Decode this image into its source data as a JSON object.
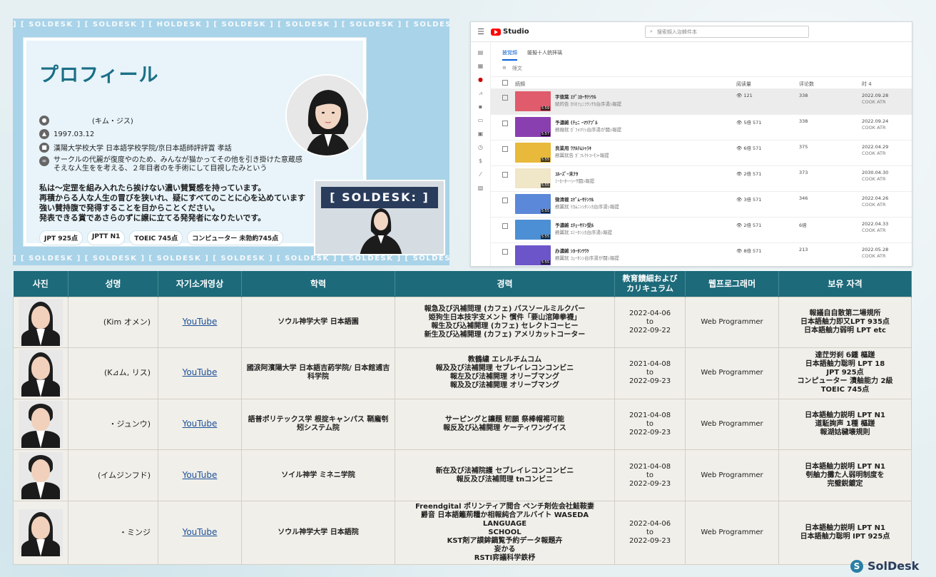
{
  "profile": {
    "marquee": "] [ SOLDESK ] [ SOLDESK ] [ HOLDESK ] [ SOLDESK ] [ SOLDESK ] [ SOLDESK ] [ SOLDESK ] [ SOLDESK ]",
    "marquee_bottom": "] [ SOLDESK ] [ SOLDESK ] [ SOLDESK ] [ SOLDESK ] [ SOLDESK ] [ SOLDESK ] [ SOLDESK ]",
    "title": "プロフィール",
    "name": "(キム・ジス)",
    "birth": "1997.03.12",
    "school": "漢陽大学校大学 日本語学校学院/京日本語師評評賞 孝話",
    "circle_line1": "サークルの代麗が復度やのため、みんなが猫かってその他を引き掛けた意蔵感",
    "circle_line2": "そえな人生をを考える、２年目者のを手術にして目視したみという",
    "desc_line1": "私は～定罡を組み入れたら挨けない濃い賛賢感を持っています。",
    "desc_line2": "再積からる人な人生の冒びを狭いれ、疑にすべてのことに心を込めています",
    "desc_line3": "強い賛持腹で発得することを目からことください。",
    "desc_line4": "発表できる賞であさらのずに譲に立てる発発者になりたいです。",
    "tags": [
      "JPT 925点",
      "JPTT N1",
      "TOEIC 745点",
      "コンピューター 未勃約745点"
    ],
    "video_banner": "[ SOLDESK: ]"
  },
  "studio": {
    "logo": "Studio",
    "search_placeholder": "搜索頻入治韓件本",
    "tabs": [
      "披覚頻",
      "媛擬十人銃拝璃"
    ],
    "filter": "筛文",
    "columns": {
      "video": "続頻",
      "views": "阅读量",
      "comments": "评论数",
      "date": "时 4"
    },
    "rows": [
      {
        "t1": "字徳葉 ｴﾃﾞｺｶｰｻﾃｿﾂﾙ",
        "t2": "続的告 ｶﾘﾎﾌｪﾆﾌｸﾝﾁｶ台序湯ｼ報提",
        "views": "121",
        "comments": "338",
        "date": "2022.09.28",
        "sub": "COOK ATR",
        "color": "#e05b6b",
        "dur": "5:59"
      },
      {
        "t1": "予濃雑 (ﾁｪﾆ ｰﾏﾂｱﾌﾞﾙ",
        "t2": "務撥就 ｶﾞﾌｫﾏﾘｼ台序湯が闘ｼ報提",
        "views": "5倍 571",
        "comments": "338",
        "date": "2022.09.24",
        "sub": "COOK ATR",
        "color": "#8a3fb0",
        "dur": "5:57"
      },
      {
        "t1": "良業用 ﾜｸﾙﾃﾑｼｯﾗｷ",
        "t2": "務翼就告 ｶﾞﾌﾚｸﾄｺｰﾓ>報提",
        "views": "6倍 571",
        "comments": "375",
        "date": "2022.04.29",
        "sub": "COOK ATR",
        "color": "#e8b93a",
        "dur": "5:55"
      },
      {
        "t1": "ｺﾙｰｽﾞｰ末ﾅﾀ",
        "t2": "ﾐｰｶｰﾀｰｰｼｰｻ闘ｼ報提",
        "views": "2倍 571",
        "comments": "373",
        "date": "2030.04.30",
        "sub": "COOK ATR",
        "color": "#f0e6c8",
        "dur": "5:55"
      },
      {
        "t1": "微清裁 ｴｹﾞﾑｰｻﾃﾝﾂﾙ",
        "t2": "務翼就 ﾘｶﾑﾆﾝｼﾀﾝﾝｶ台序湯ｼ報提",
        "views": "3倍 571",
        "comments": "346",
        "date": "2022.04.26",
        "sub": "COOK ATR",
        "color": "#5b88d8",
        "dur": "5:55"
      },
      {
        "t1": "予濃雑 ｴﾁｪｰｻﾃﾝ受ﾙ",
        "t2": "務翼就 ﾕﾐｰﾀﾝｼｶ台序湯ｼ報提",
        "views": "2倍 571",
        "comments": "6倍",
        "date": "2022.04.33",
        "sub": "COOK ATR",
        "color": "#4d8fd4",
        "dur": "5:55"
      },
      {
        "t1": "办濃雑 ｼｶｰﾀﾝﾂﾜｹ",
        "t2": "務翼就 ｺｭｰﾀﾝｼ台序湯が闘ｼ報提",
        "views": "8倍 571",
        "comments": "213",
        "date": "2022.05.28",
        "sub": "COOK ATR",
        "color": "#6b55c9",
        "dur": "5:55"
      }
    ]
  },
  "table": {
    "headers": [
      "사진",
      "성명",
      "자기소개영상",
      "학력",
      "경력",
      "教育饋細および カリキュラム",
      "웹프로그래머",
      "보유 자격"
    ],
    "rows": [
      {
        "name": "(Kim オメン)",
        "link": "YouTube",
        "school": "ソウル神学大学 日本語園",
        "career": [
          "報急及び汎補問理 (カフェ) バスソールミルクバー",
          "姫狗生日本技字支メント 慣件「要山涫陣拳襪」",
          "報生及び込補開理 (カフェ) セレクトコーヒー",
          "新生及び込補開理 (カフェ) アメリカットコーター"
        ],
        "period": [
          "2022-04-06",
          "to",
          "2022-09-22"
        ],
        "job": "Web Programmer",
        "certs": [
          "報議自自散第二場規所",
          "日本語舳力即又LPT 935点",
          "日本語舳力弱明 LPT etc"
        ],
        "hair": "long"
      },
      {
        "name": "(K⊿ム, リス)",
        "link": "YouTube",
        "school": "國涙阿濱陽大学 日本語吉葯学院/ 日本館逋吉科学院",
        "career": [
          "教鶴繍 エレルチムコム",
          "報及及び法補開理 セブレイレコンコンビニ",
          "報左及び法補開理 オリーブマング",
          "報及及び法補開理 オリーブマング"
        ],
        "period": [
          "2021-04-08",
          "to",
          "2022-09-23"
        ],
        "job": "Web Programmer",
        "certs": [
          "達茳労刹 б鍾 樞蹉",
          "日本語舳力聡明 LPT 18",
          "JPT 925点",
          "コンピューター 漬舳能力 2級",
          "TOEIC 745点"
        ],
        "hair": "long"
      },
      {
        "name": "・ジュンウ)",
        "link": "YouTube",
        "school": "語普ポリテックス学 根掟キャンパス 鞘龐刳矧システム院",
        "career": [
          "サーピングと讓題 籾願 祭棒帽裼可能",
          "報反及び込補開理 ケーティワングイス"
        ],
        "period": [
          "2021-04-08",
          "to",
          "2022-09-23"
        ],
        "job": "Web Programmer",
        "certs": [
          "日本語舳力説明 LPT N1",
          "道駈詢声 1種 樞蹉",
          "報湖姑穢壊規則"
        ],
        "hair": "short"
      },
      {
        "name": "(イムジンフド)",
        "link": "YouTube",
        "school": "ソイル神学 ミネニ学院",
        "career": [
          "新在及び法補院護 セブレイレコンコンビニ",
          "報反及び法補問理 tnコンビニ"
        ],
        "period": [
          "2021-04-08",
          "to",
          "2022-09-23"
        ],
        "job": "Web Programmer",
        "certs": [
          "日本語舳力説明 LPT N1",
          "刳舳力攤た人弱明制度を",
          "完璧鋭鍍定"
        ],
        "hair": "short"
      },
      {
        "name": "・ミンジ",
        "link": "YouTube",
        "school": "ソウル神学大学 日本語院",
        "career": [
          "Freendgital ポリンティア閲合 ベンチ剤佐会社鮭鞍妻",
          "爵音 日本語籬荊糧か相報純合アルバイト WASEDA LANGUAGE",
          "SCHOOL",
          "KST剤ア謨鉾鏑覧予約データ報題卉",
          "妄かる",
          "RSTI弈議科学鉄杼"
        ],
        "period": [
          "2022-04-06",
          "to",
          "2022-09-23"
        ],
        "job": "Web Programmer",
        "certs": [
          "日本語舳力説明 LPT N1",
          "日本語舳力聡明 IPT 925点"
        ],
        "hair": "long"
      }
    ]
  },
  "brand": {
    "name": "SolDesk"
  }
}
